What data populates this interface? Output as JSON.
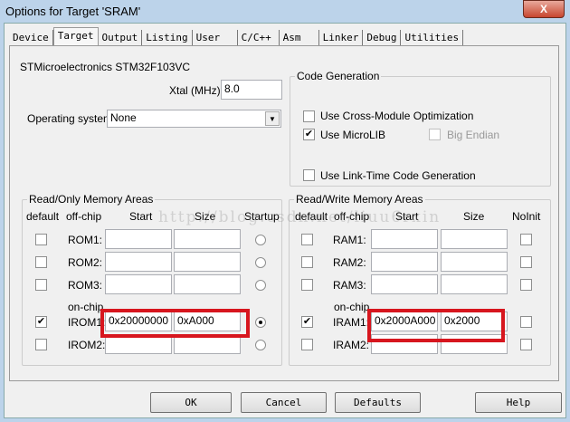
{
  "window": {
    "title": "Options for Target 'SRAM'",
    "close": "X"
  },
  "tabs": [
    "Device",
    "Target",
    "Output",
    "Listing",
    "User",
    "C/C++",
    "Asm",
    "Linker",
    "Debug",
    "Utilities"
  ],
  "device": "STMicroelectronics STM32F103VC",
  "xtal": {
    "label": "Xtal (MHz):",
    "value": "8.0"
  },
  "os": {
    "label": "Operating system:",
    "value": "None"
  },
  "codegen": {
    "title": "Code Generation",
    "cross_module": "Use Cross-Module Optimization",
    "microlib": "Use MicroLIB",
    "big_endian": "Big Endian",
    "ltcg": "Use Link-Time Code Generation"
  },
  "rom": {
    "title": "Read/Only Memory Areas",
    "h_default": "default",
    "h_offchip": "off-chip",
    "h_start": "Start",
    "h_size": "Size",
    "h_startup": "Startup",
    "onchip": "on-chip",
    "rows": [
      {
        "label": "ROM1:",
        "start": "",
        "size": ""
      },
      {
        "label": "ROM2:",
        "start": "",
        "size": ""
      },
      {
        "label": "ROM3:",
        "start": "",
        "size": ""
      },
      {
        "label": "IROM1:",
        "start": "0x20000000",
        "size": "0xA000"
      },
      {
        "label": "IROM2:",
        "start": "",
        "size": ""
      }
    ]
  },
  "ram": {
    "title": "Read/Write Memory Areas",
    "h_default": "default",
    "h_offchip": "off-chip",
    "h_start": "Start",
    "h_size": "Size",
    "h_noinit": "NoInit",
    "onchip": "on-chip",
    "rows": [
      {
        "label": "RAM1:",
        "start": "",
        "size": ""
      },
      {
        "label": "RAM2:",
        "start": "",
        "size": ""
      },
      {
        "label": "RAM3:",
        "start": "",
        "size": ""
      },
      {
        "label": "IRAM1:",
        "start": "0x2000A000",
        "size": "0x2000"
      },
      {
        "label": "IRAM2:",
        "start": "",
        "size": ""
      }
    ]
  },
  "buttons": {
    "ok": "OK",
    "cancel": "Cancel",
    "defaults": "Defaults",
    "help": "Help"
  },
  "watermark": "http://blog.csdn.net/liuu6rxin"
}
